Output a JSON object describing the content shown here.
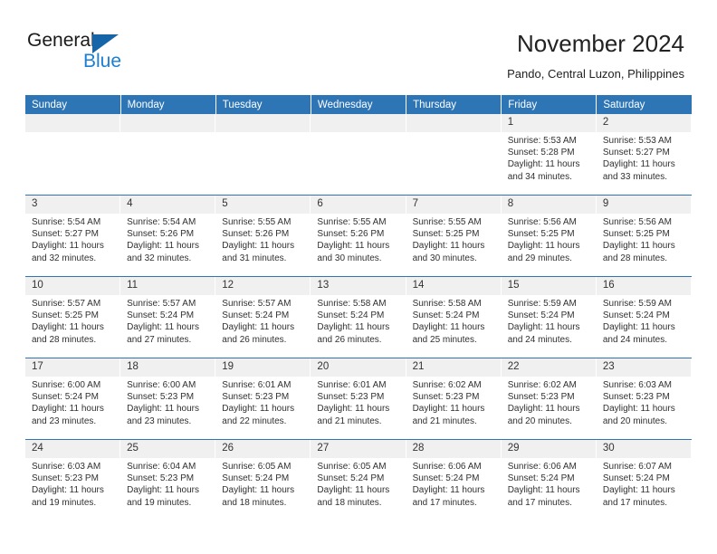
{
  "logo": {
    "word_one": "General",
    "word_two": "Blue",
    "triangle_icon": "triangle-icon",
    "brand_blue": "#1a7fd4",
    "triangle_blue": "#1565a8"
  },
  "header": {
    "title": "November 2024",
    "location": "Pando, Central Luzon, Philippines"
  },
  "calendar": {
    "header_bg": "#2e75b6",
    "daynum_bg": "#f0f0f0",
    "weekdays": [
      "Sunday",
      "Monday",
      "Tuesday",
      "Wednesday",
      "Thursday",
      "Friday",
      "Saturday"
    ],
    "weeks": [
      [
        {
          "empty": true
        },
        {
          "empty": true
        },
        {
          "empty": true
        },
        {
          "empty": true
        },
        {
          "empty": true
        },
        {
          "day": "1",
          "sunrise": "Sunrise: 5:53 AM",
          "sunset": "Sunset: 5:28 PM",
          "daylight": "Daylight: 11 hours and 34 minutes."
        },
        {
          "day": "2",
          "sunrise": "Sunrise: 5:53 AM",
          "sunset": "Sunset: 5:27 PM",
          "daylight": "Daylight: 11 hours and 33 minutes."
        }
      ],
      [
        {
          "day": "3",
          "sunrise": "Sunrise: 5:54 AM",
          "sunset": "Sunset: 5:27 PM",
          "daylight": "Daylight: 11 hours and 32 minutes."
        },
        {
          "day": "4",
          "sunrise": "Sunrise: 5:54 AM",
          "sunset": "Sunset: 5:26 PM",
          "daylight": "Daylight: 11 hours and 32 minutes."
        },
        {
          "day": "5",
          "sunrise": "Sunrise: 5:55 AM",
          "sunset": "Sunset: 5:26 PM",
          "daylight": "Daylight: 11 hours and 31 minutes."
        },
        {
          "day": "6",
          "sunrise": "Sunrise: 5:55 AM",
          "sunset": "Sunset: 5:26 PM",
          "daylight": "Daylight: 11 hours and 30 minutes."
        },
        {
          "day": "7",
          "sunrise": "Sunrise: 5:55 AM",
          "sunset": "Sunset: 5:25 PM",
          "daylight": "Daylight: 11 hours and 30 minutes."
        },
        {
          "day": "8",
          "sunrise": "Sunrise: 5:56 AM",
          "sunset": "Sunset: 5:25 PM",
          "daylight": "Daylight: 11 hours and 29 minutes."
        },
        {
          "day": "9",
          "sunrise": "Sunrise: 5:56 AM",
          "sunset": "Sunset: 5:25 PM",
          "daylight": "Daylight: 11 hours and 28 minutes."
        }
      ],
      [
        {
          "day": "10",
          "sunrise": "Sunrise: 5:57 AM",
          "sunset": "Sunset: 5:25 PM",
          "daylight": "Daylight: 11 hours and 28 minutes."
        },
        {
          "day": "11",
          "sunrise": "Sunrise: 5:57 AM",
          "sunset": "Sunset: 5:24 PM",
          "daylight": "Daylight: 11 hours and 27 minutes."
        },
        {
          "day": "12",
          "sunrise": "Sunrise: 5:57 AM",
          "sunset": "Sunset: 5:24 PM",
          "daylight": "Daylight: 11 hours and 26 minutes."
        },
        {
          "day": "13",
          "sunrise": "Sunrise: 5:58 AM",
          "sunset": "Sunset: 5:24 PM",
          "daylight": "Daylight: 11 hours and 26 minutes."
        },
        {
          "day": "14",
          "sunrise": "Sunrise: 5:58 AM",
          "sunset": "Sunset: 5:24 PM",
          "daylight": "Daylight: 11 hours and 25 minutes."
        },
        {
          "day": "15",
          "sunrise": "Sunrise: 5:59 AM",
          "sunset": "Sunset: 5:24 PM",
          "daylight": "Daylight: 11 hours and 24 minutes."
        },
        {
          "day": "16",
          "sunrise": "Sunrise: 5:59 AM",
          "sunset": "Sunset: 5:24 PM",
          "daylight": "Daylight: 11 hours and 24 minutes."
        }
      ],
      [
        {
          "day": "17",
          "sunrise": "Sunrise: 6:00 AM",
          "sunset": "Sunset: 5:24 PM",
          "daylight": "Daylight: 11 hours and 23 minutes."
        },
        {
          "day": "18",
          "sunrise": "Sunrise: 6:00 AM",
          "sunset": "Sunset: 5:23 PM",
          "daylight": "Daylight: 11 hours and 23 minutes."
        },
        {
          "day": "19",
          "sunrise": "Sunrise: 6:01 AM",
          "sunset": "Sunset: 5:23 PM",
          "daylight": "Daylight: 11 hours and 22 minutes."
        },
        {
          "day": "20",
          "sunrise": "Sunrise: 6:01 AM",
          "sunset": "Sunset: 5:23 PM",
          "daylight": "Daylight: 11 hours and 21 minutes."
        },
        {
          "day": "21",
          "sunrise": "Sunrise: 6:02 AM",
          "sunset": "Sunset: 5:23 PM",
          "daylight": "Daylight: 11 hours and 21 minutes."
        },
        {
          "day": "22",
          "sunrise": "Sunrise: 6:02 AM",
          "sunset": "Sunset: 5:23 PM",
          "daylight": "Daylight: 11 hours and 20 minutes."
        },
        {
          "day": "23",
          "sunrise": "Sunrise: 6:03 AM",
          "sunset": "Sunset: 5:23 PM",
          "daylight": "Daylight: 11 hours and 20 minutes."
        }
      ],
      [
        {
          "day": "24",
          "sunrise": "Sunrise: 6:03 AM",
          "sunset": "Sunset: 5:23 PM",
          "daylight": "Daylight: 11 hours and 19 minutes."
        },
        {
          "day": "25",
          "sunrise": "Sunrise: 6:04 AM",
          "sunset": "Sunset: 5:23 PM",
          "daylight": "Daylight: 11 hours and 19 minutes."
        },
        {
          "day": "26",
          "sunrise": "Sunrise: 6:05 AM",
          "sunset": "Sunset: 5:24 PM",
          "daylight": "Daylight: 11 hours and 18 minutes."
        },
        {
          "day": "27",
          "sunrise": "Sunrise: 6:05 AM",
          "sunset": "Sunset: 5:24 PM",
          "daylight": "Daylight: 11 hours and 18 minutes."
        },
        {
          "day": "28",
          "sunrise": "Sunrise: 6:06 AM",
          "sunset": "Sunset: 5:24 PM",
          "daylight": "Daylight: 11 hours and 17 minutes."
        },
        {
          "day": "29",
          "sunrise": "Sunrise: 6:06 AM",
          "sunset": "Sunset: 5:24 PM",
          "daylight": "Daylight: 11 hours and 17 minutes."
        },
        {
          "day": "30",
          "sunrise": "Sunrise: 6:07 AM",
          "sunset": "Sunset: 5:24 PM",
          "daylight": "Daylight: 11 hours and 17 minutes."
        }
      ]
    ]
  }
}
